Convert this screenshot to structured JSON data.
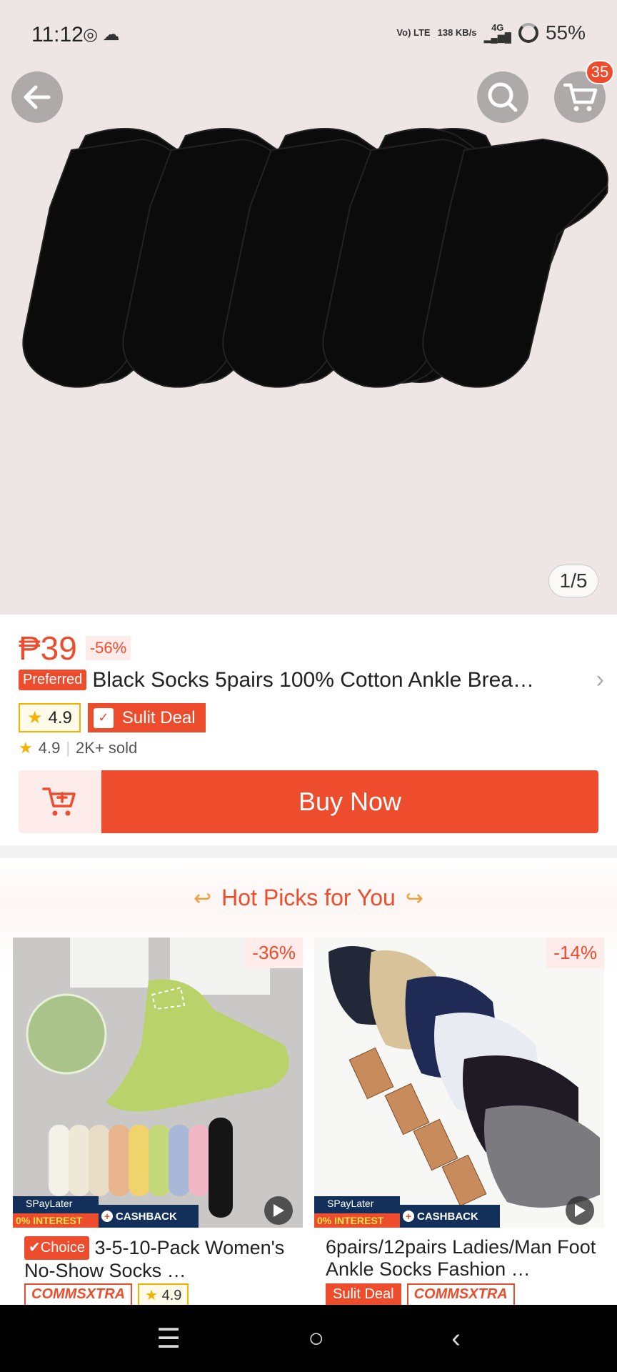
{
  "status_bar": {
    "time": "11:12",
    "network_small_1": "Vo) LTE",
    "network_speed": "138 KB/s",
    "network_type": "4G",
    "battery": "55%"
  },
  "header": {
    "cart_count": "35"
  },
  "gallery": {
    "counter": "1/5"
  },
  "product": {
    "price": "₱39",
    "discount": "-56%",
    "preferred_label": "Preferred",
    "title": "Black Socks 5pairs 100% Cotton Ankle Brea…",
    "rating_badge": "4.9",
    "sulit_label": "Sulit Deal",
    "rating": "4.9",
    "sold": "2K+ sold",
    "buy_now": "Buy Now"
  },
  "hot_picks": {
    "title": "Hot Picks for You",
    "cards": [
      {
        "discount": "-36%",
        "paylater_top": "SPayLater",
        "paylater_bottom": "0% INTEREST",
        "cashback": "CASHBACK",
        "choice_label": "✔Choice",
        "title": "3-5-10-Pack Women's No-Show Socks …",
        "badge_1": "COMMSXTRA",
        "badge_2": "4.9"
      },
      {
        "discount": "-14%",
        "paylater_top": "SPayLater",
        "paylater_bottom": "0% INTEREST",
        "cashback": "CASHBACK",
        "title": "6pairs/12pairs Ladies/Man Foot Ankle Socks Fashion …",
        "badge_1": "Sulit Deal",
        "badge_2": "COMMSXTRA"
      }
    ]
  },
  "colors": {
    "accent": "#ee4d2d",
    "star": "#f5b000",
    "hero_bg": "#ede6e4"
  },
  "icons": [
    "back-arrow-icon",
    "search-icon",
    "cart-icon",
    "add-to-cart-icon",
    "star-icon",
    "play-icon",
    "menu-icon",
    "home-icon",
    "back-nav-icon"
  ]
}
